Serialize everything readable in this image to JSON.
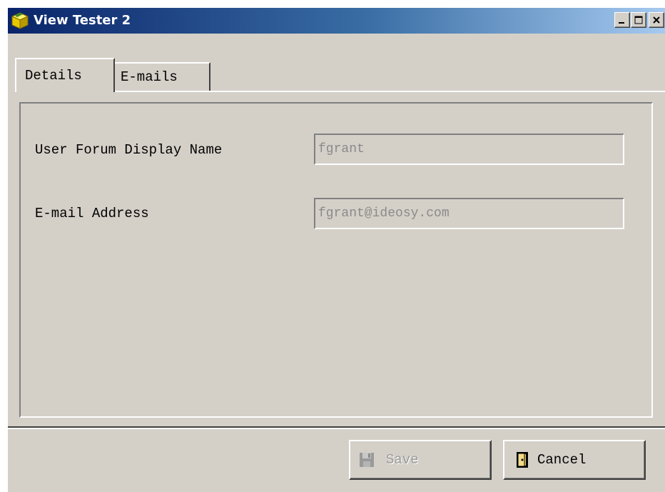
{
  "window": {
    "title": "View Tester 2",
    "app_icon": "yellow-cube-icon",
    "controls": {
      "minimize_icon": "minimize-icon",
      "maximize_icon": "maximize-icon",
      "close_icon": "close-icon"
    }
  },
  "tabs": [
    {
      "label": "Details",
      "active": true
    },
    {
      "label": "E-mails",
      "active": false
    }
  ],
  "form": {
    "display_name": {
      "label": "User Forum Display Name",
      "value": "fgrant",
      "enabled": false
    },
    "email": {
      "label": "E-mail Address",
      "value": "fgrant@ideosy.com",
      "enabled": false
    }
  },
  "buttons": {
    "save": {
      "label": "Save",
      "icon": "floppy-disk-icon",
      "enabled": false
    },
    "cancel": {
      "label": "Cancel",
      "icon": "exit-door-icon",
      "enabled": true
    }
  },
  "colors": {
    "titlebar_start": "#0a246a",
    "titlebar_end": "#a6caf0",
    "face": "#d4d0c8",
    "disabled_text": "#8a8a8a"
  }
}
